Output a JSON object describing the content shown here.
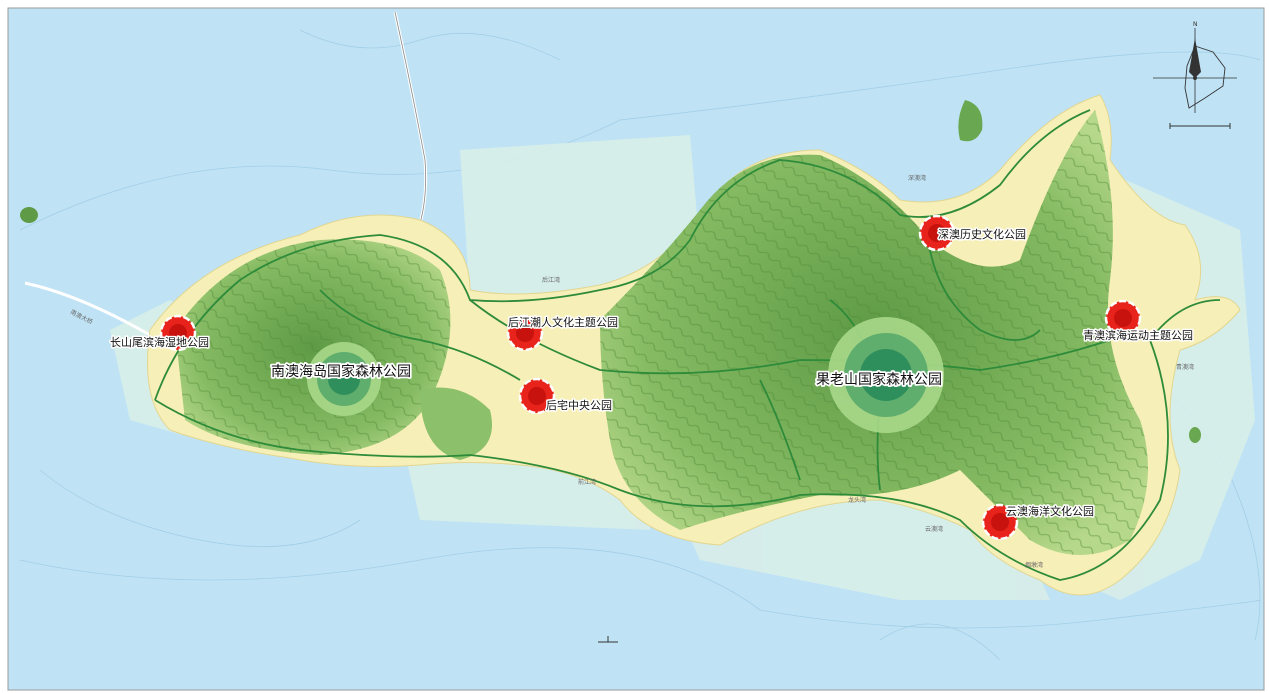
{
  "map": {
    "forest_parks": [
      {
        "id": "nanao-island",
        "label": "南澳海岛国家森林公园"
      },
      {
        "id": "guolaoshan",
        "label": "果老山国家森林公园"
      }
    ],
    "theme_parks": [
      {
        "id": "changshanwei",
        "label": "长山尾滨海湿地公园"
      },
      {
        "id": "houjiang",
        "label": "后江潮人文化主题公园"
      },
      {
        "id": "houzhai",
        "label": "后宅中央公园"
      },
      {
        "id": "shenao",
        "label": "深澳历史文化公园"
      },
      {
        "id": "qingao",
        "label": "青澳滨海运动主题公园"
      },
      {
        "id": "yunao",
        "label": "云澳海洋文化公园"
      }
    ],
    "place_names": [
      {
        "id": "houjiang-bay",
        "label": "后江湾"
      },
      {
        "id": "qianjiang-bay",
        "label": "前江湾"
      },
      {
        "id": "shenao-bay",
        "label": "深澳湾"
      },
      {
        "id": "yunao-bay",
        "label": "云澳湾"
      },
      {
        "id": "qingao-bay",
        "label": "青澳湾"
      },
      {
        "id": "yanzhou-bay",
        "label": "烟墩湾"
      },
      {
        "id": "longtou-bay",
        "label": "龙头湾"
      },
      {
        "id": "bridge",
        "label": "南澳大桥"
      }
    ],
    "colors": {
      "sea": "#bfe3f5",
      "park_zone": "#d8eee9",
      "urban": "#f7efb8",
      "forest": "#8cc06a",
      "forest_dark": "#4f8d3c",
      "road": "#2e8b3a",
      "theme_park_marker": "#e8231c",
      "forest_park_marker": "#2f8f5c"
    },
    "compass": {
      "north_label": "N"
    }
  }
}
